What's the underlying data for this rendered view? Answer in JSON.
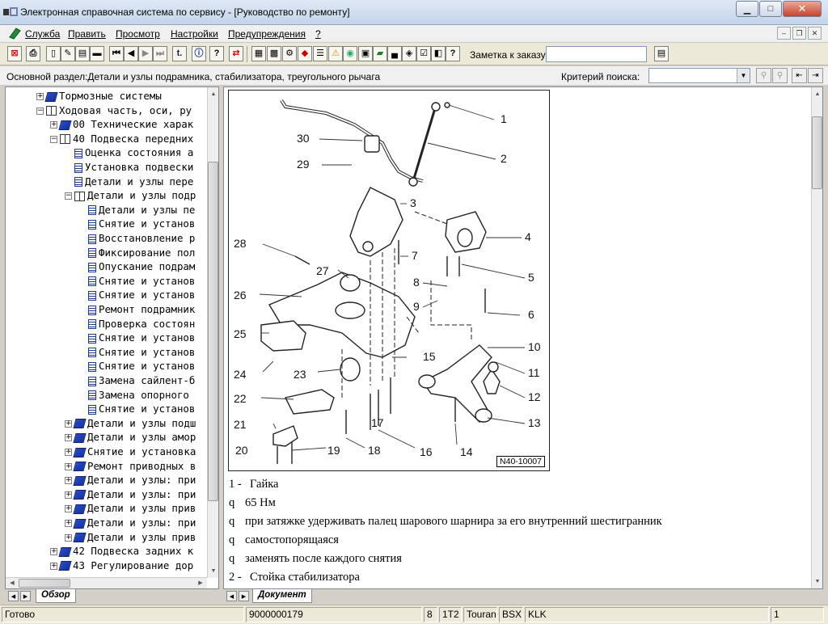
{
  "window": {
    "title": "Электронная справочная система по сервису - [Руководство по ремонту]"
  },
  "menu": [
    "Служба",
    "Править",
    "Просмотр",
    "Настройки",
    "Предупреждения",
    "?"
  ],
  "toolbar": {
    "note_label": "Заметка к заказу:",
    "note_value": ""
  },
  "section": {
    "label": "Основной раздел:Детали и узлы подрамника, стабилизатора, треугольного рычага",
    "criteria_label": "Критерий  поиска:",
    "criteria_value": ""
  },
  "tree": [
    {
      "level": 2,
      "exp": "+",
      "icon": "bk",
      "label": "Тормозные системы"
    },
    {
      "level": 2,
      "exp": "-",
      "icon": "bko",
      "label": "Ходовая часть, оси, ру"
    },
    {
      "level": 3,
      "exp": "+",
      "icon": "bk",
      "label": "00 Технические харак"
    },
    {
      "level": 3,
      "exp": "-",
      "icon": "bko",
      "label": "40 Подвеска передних"
    },
    {
      "level": 4,
      "exp": "",
      "icon": "doc",
      "label": "Оценка состояния а"
    },
    {
      "level": 4,
      "exp": "",
      "icon": "doc",
      "label": "Установка подвески"
    },
    {
      "level": 4,
      "exp": "",
      "icon": "doc",
      "label": "Детали и узлы пере"
    },
    {
      "level": 4,
      "exp": "-",
      "icon": "bko",
      "label": "Детали и узлы подр"
    },
    {
      "level": 5,
      "exp": "",
      "icon": "doc",
      "label": "Детали и узлы пе"
    },
    {
      "level": 5,
      "exp": "",
      "icon": "doc",
      "label": "Снятие и установ"
    },
    {
      "level": 5,
      "exp": "",
      "icon": "doc",
      "label": "Восстановление р"
    },
    {
      "level": 5,
      "exp": "",
      "icon": "doc",
      "label": "Фиксирование пол"
    },
    {
      "level": 5,
      "exp": "",
      "icon": "doc",
      "label": "Опускание подрам"
    },
    {
      "level": 5,
      "exp": "",
      "icon": "doc",
      "label": "Снятие и установ"
    },
    {
      "level": 5,
      "exp": "",
      "icon": "doc",
      "label": "Снятие и установ"
    },
    {
      "level": 5,
      "exp": "",
      "icon": "doc",
      "label": "Ремонт подрамник"
    },
    {
      "level": 5,
      "exp": "",
      "icon": "doc",
      "label": "Проверка состоян"
    },
    {
      "level": 5,
      "exp": "",
      "icon": "doc",
      "label": "Снятие и установ"
    },
    {
      "level": 5,
      "exp": "",
      "icon": "doc",
      "label": "Снятие и установ"
    },
    {
      "level": 5,
      "exp": "",
      "icon": "doc",
      "label": "Снятие и установ"
    },
    {
      "level": 5,
      "exp": "",
      "icon": "doc",
      "label": "Замена сайлент-б"
    },
    {
      "level": 5,
      "exp": "",
      "icon": "doc",
      "label": "Замена опорного"
    },
    {
      "level": 5,
      "exp": "",
      "icon": "doc",
      "label": "Снятие и установ"
    },
    {
      "level": 4,
      "exp": "+",
      "icon": "bk",
      "label": "Детали и узлы подш"
    },
    {
      "level": 4,
      "exp": "+",
      "icon": "bk",
      "label": "Детали и узлы амор"
    },
    {
      "level": 4,
      "exp": "+",
      "icon": "bk",
      "label": "Снятие и установка"
    },
    {
      "level": 4,
      "exp": "+",
      "icon": "bk",
      "label": "Ремонт приводных в"
    },
    {
      "level": 4,
      "exp": "+",
      "icon": "bk",
      "label": "Детали и узлы: при"
    },
    {
      "level": 4,
      "exp": "+",
      "icon": "bk",
      "label": "Детали и узлы: при"
    },
    {
      "level": 4,
      "exp": "+",
      "icon": "bk",
      "label": "Детали и узлы прив"
    },
    {
      "level": 4,
      "exp": "+",
      "icon": "bk",
      "label": "Детали и узлы: при"
    },
    {
      "level": 4,
      "exp": "+",
      "icon": "bk",
      "label": "Детали и узлы прив"
    },
    {
      "level": 3,
      "exp": "+",
      "icon": "bk",
      "label": "42 Подвеска задних к"
    },
    {
      "level": 3,
      "exp": "+",
      "icon": "bk",
      "label": "43 Регулирование дор"
    }
  ],
  "tabs": {
    "left": "Обзор",
    "right": "Документ"
  },
  "figure": {
    "code": "N40-10007",
    "callouts": [
      "1",
      "2",
      "3",
      "4",
      "5",
      "6",
      "7",
      "8",
      "9",
      "10",
      "11",
      "12",
      "13",
      "14",
      "15",
      "16",
      "17",
      "18",
      "19",
      "20",
      "21",
      "22",
      "23",
      "24",
      "25",
      "26",
      "27",
      "28",
      "29",
      "30"
    ]
  },
  "document": [
    {
      "bullet": "1 -",
      "text": "Гайка"
    },
    {
      "bullet": "q",
      "text": "65 Нм"
    },
    {
      "bullet": "q",
      "text": "при затяжке удерживать палец шарового шарнира за его внутренний шестигранник"
    },
    {
      "bullet": "q",
      "text": "самостопорящаяся"
    },
    {
      "bullet": "q",
      "text": "заменять после каждого снятия"
    },
    {
      "bullet": "2 -",
      "text": "Стойка стабилизатора"
    }
  ],
  "status": {
    "state": "Готово",
    "code": "9000000179",
    "f1": "8",
    "f2": "1T2",
    "model": "Touran",
    "engine": "BSX",
    "gear": "KLK",
    "page": "1"
  }
}
